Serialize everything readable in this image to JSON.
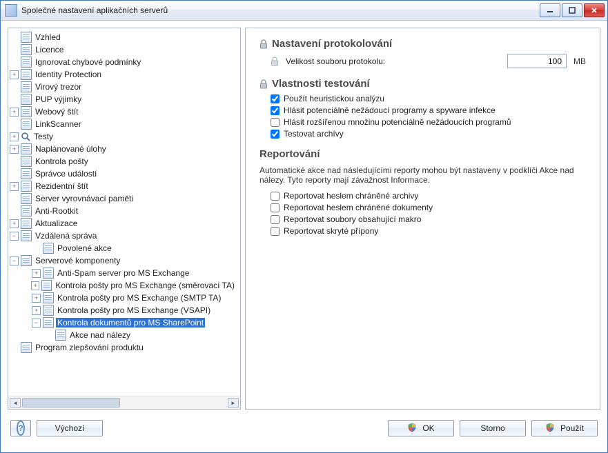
{
  "window": {
    "title": "Společné nastavení aplikačních serverů"
  },
  "tree": [
    {
      "label": "Vzhled",
      "expander": "none",
      "icon": "page"
    },
    {
      "label": "Licence",
      "expander": "none",
      "icon": "page"
    },
    {
      "label": "Ignorovat chybové podmínky",
      "expander": "none",
      "icon": "page"
    },
    {
      "label": "Identity Protection",
      "expander": "plus",
      "icon": "page"
    },
    {
      "label": "Virový trezor",
      "expander": "none",
      "icon": "page"
    },
    {
      "label": "PUP výjimky",
      "expander": "none",
      "icon": "page"
    },
    {
      "label": "Webový štít",
      "expander": "plus",
      "icon": "page"
    },
    {
      "label": "LinkScanner",
      "expander": "none",
      "icon": "page"
    },
    {
      "label": "Testy",
      "expander": "plus",
      "icon": "mag"
    },
    {
      "label": "Naplánované úlohy",
      "expander": "plus",
      "icon": "page"
    },
    {
      "label": "Kontrola pošty",
      "expander": "none",
      "icon": "page"
    },
    {
      "label": "Správce událostí",
      "expander": "none",
      "icon": "page"
    },
    {
      "label": "Rezidentní štít",
      "expander": "plus",
      "icon": "page"
    },
    {
      "label": "Server vyrovnávací paměti",
      "expander": "none",
      "icon": "page"
    },
    {
      "label": "Anti-Rootkit",
      "expander": "none",
      "icon": "page"
    },
    {
      "label": "Aktualizace",
      "expander": "plus",
      "icon": "page"
    },
    {
      "label": "Vzdálená správa",
      "expander": "minus",
      "icon": "page",
      "children": [
        {
          "label": "Povolené akce",
          "expander": "none",
          "icon": "page"
        }
      ]
    },
    {
      "label": "Serverové komponenty",
      "expander": "minus",
      "icon": "page",
      "children": [
        {
          "label": "Anti-Spam server pro MS Exchange",
          "expander": "plus",
          "icon": "page"
        },
        {
          "label": "Kontrola pošty pro MS Exchange (směrovací TA)",
          "expander": "plus",
          "icon": "page"
        },
        {
          "label": "Kontrola pošty pro MS Exchange (SMTP TA)",
          "expander": "plus",
          "icon": "page"
        },
        {
          "label": "Kontrola pošty pro MS Exchange (VSAPI)",
          "expander": "plus",
          "icon": "page"
        },
        {
          "label": "Kontrola dokumentů pro MS SharePoint",
          "expander": "minus",
          "icon": "page",
          "selected": true,
          "children": [
            {
              "label": "Akce nad nálezy",
              "expander": "none",
              "icon": "page"
            }
          ]
        }
      ]
    },
    {
      "label": "Program zlepšování produktu",
      "expander": "none",
      "icon": "page"
    }
  ],
  "detail": {
    "section_logging": {
      "title": "Nastavení protokolování",
      "file_size_label": "Velikost souboru protokolu:",
      "file_size_value": "100",
      "file_size_unit": "MB"
    },
    "section_testprops": {
      "title": "Vlastnosti testování",
      "options": [
        {
          "label": "Použít heuristickou analýzu",
          "checked": true
        },
        {
          "label": "Hlásit potenciálně nežádoucí programy a spyware infekce",
          "checked": true
        },
        {
          "label": "Hlásit rozšířenou množinu potenciálně nežádoucích programů",
          "checked": false
        },
        {
          "label": "Testovat archívy",
          "checked": true
        }
      ]
    },
    "section_reporting": {
      "title": "Reportování",
      "description": "Automatické akce nad následujícími reporty mohou být nastaveny v podklíči Akce nad nálezy. Tyto reporty mají závažnost Informace.",
      "options": [
        {
          "label": "Reportovat heslem chráněné archivy",
          "checked": false
        },
        {
          "label": "Reportovat heslem chráněné dokumenty",
          "checked": false
        },
        {
          "label": "Reportovat soubory obsahující makro",
          "checked": false
        },
        {
          "label": "Reportovat skryté přípony",
          "checked": false
        }
      ]
    }
  },
  "footer": {
    "defaults": "Výchozí",
    "ok": "OK",
    "cancel": "Storno",
    "apply": "Použít"
  }
}
